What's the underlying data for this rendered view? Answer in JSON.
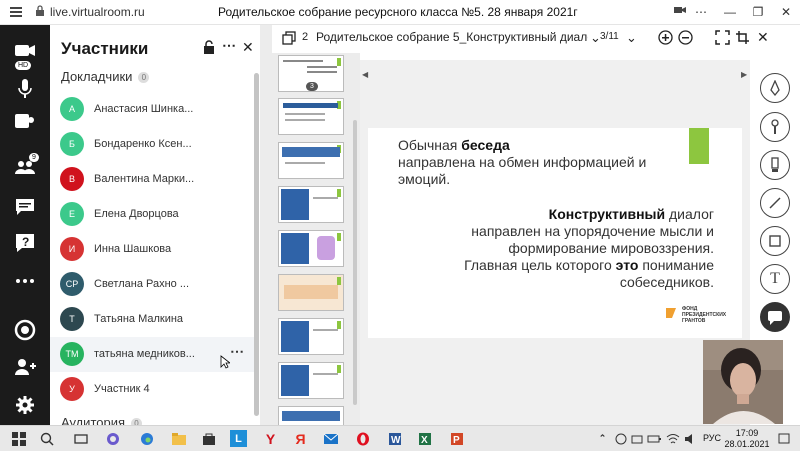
{
  "browser": {
    "url": "live.virtualroom.ru",
    "tab_title": "Родительское собрание ресурсного класса №5. 28 января 2021г"
  },
  "rail": {
    "badges": {
      "screen_share": "HD",
      "participants_count": "9"
    }
  },
  "participants_panel": {
    "title": "Участники",
    "speakers_label": "Докладчики",
    "speakers_count": "0",
    "audience_label": "Аудитория",
    "audience_count": "0",
    "members": [
      {
        "initials": "А",
        "name": "Анастасия Шинка...",
        "color": "#3cc98b"
      },
      {
        "initials": "Б",
        "name": "Бондаренко Ксен...",
        "color": "#3cc98b"
      },
      {
        "initials": "В",
        "name": "Валентина Марки...",
        "color": "#d0121d"
      },
      {
        "initials": "Е",
        "name": "Елена Дворцова",
        "color": "#3cc98b"
      },
      {
        "initials": "И",
        "name": "Инна Шашкова",
        "color": "#d63333"
      },
      {
        "initials": "СР",
        "name": "Светлана Рахно ...",
        "color": "#2f5c6c"
      },
      {
        "initials": "Т",
        "name": "Татьяна Малкина",
        "color": "#2d4850"
      },
      {
        "initials": "ТМ",
        "name": "татьяна медников...",
        "color": "#27b35f"
      },
      {
        "initials": "У",
        "name": "Участник 4",
        "color": "#d63333"
      }
    ]
  },
  "document": {
    "pages_label": "2",
    "title": "Родительское собрание 5_Конструктивный диало",
    "page_counter": "3/11"
  },
  "thumbnails": {
    "first_page_number": "3"
  },
  "slide": {
    "line1_a": "Обычная ",
    "line1_b": "беседа",
    "line2": "направлена на обмен информацией и",
    "line3": "эмоций.",
    "para2_a": "Конструктивный",
    "para2_b": " диалог",
    "para2_l2": "направлен на упорядочение мысли и",
    "para2_l3": "формирование мировоззрения.",
    "para2_l4a": "Главная цель которого ",
    "para2_l4b": "это",
    "para2_l4c": " понимание",
    "para2_l5": "собеседников.",
    "logo_line1": "ФОНД",
    "logo_line2": "ПРЕЗИДЕНТСКИХ",
    "logo_line3": "ГРАНТОВ",
    "accent_color": "#8dc63f"
  },
  "taskbar": {
    "lang": "РУС",
    "time": "17:09",
    "date": "28.01.2021",
    "app_letters": {
      "l": "L",
      "y": "Y",
      "ya": "Я"
    }
  }
}
